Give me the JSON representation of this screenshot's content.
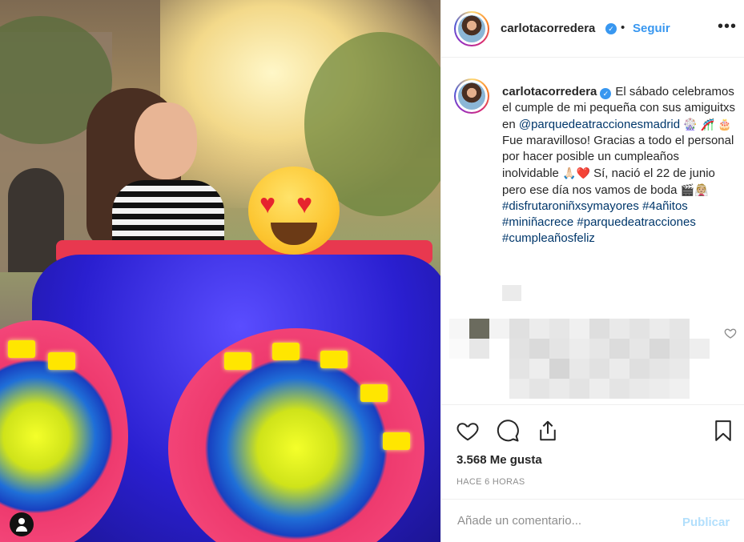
{
  "post": {
    "username": "carlotacorredera",
    "verified_mark": "✓",
    "separator": "•",
    "follow_label": "Seguir",
    "more_label": "•••"
  },
  "caption": {
    "username": "carlotacorredera",
    "text_1": "El sábado celebramos el cumple de mi pequeña con sus amiguitxs en ",
    "mention": "@parquedeatracciones​madrid",
    "emoji_1": "🎡 🎢",
    "emoji_2": "🎂",
    "text_2": " Fue maravilloso! Gracias a todo el personal por hacer posible un cumpleaños inolvidable ",
    "emoji_3": "🙏🏻",
    "emoji_4": "❤️",
    "text_3": " Sí, nació el 22 de junio pero ese día nos vamos de boda ",
    "emoji_5": "🎬👰🏼",
    "hashtags": [
      "#disfrutaroniñxsymayores",
      "#4añitos",
      "#miniñacrece",
      "#parquedeatracciones",
      "#cumpleañosfeliz"
    ]
  },
  "icons": {
    "like": "heart-icon",
    "comment": "comment-icon",
    "share": "share-icon",
    "save": "bookmark-icon",
    "verified": "verified-badge-icon",
    "user": "user-icon"
  },
  "colors": {
    "link": "#00376b",
    "accent": "#3897f0",
    "muted": "#8e8e8e",
    "publish_disabled": "#b2dffc"
  },
  "stats": {
    "likes": "3.568 Me gusta",
    "time_ago": "HACE 6 HORAS"
  },
  "comment_box": {
    "placeholder": "Añade un comentario...",
    "publish_label": "Publicar"
  }
}
